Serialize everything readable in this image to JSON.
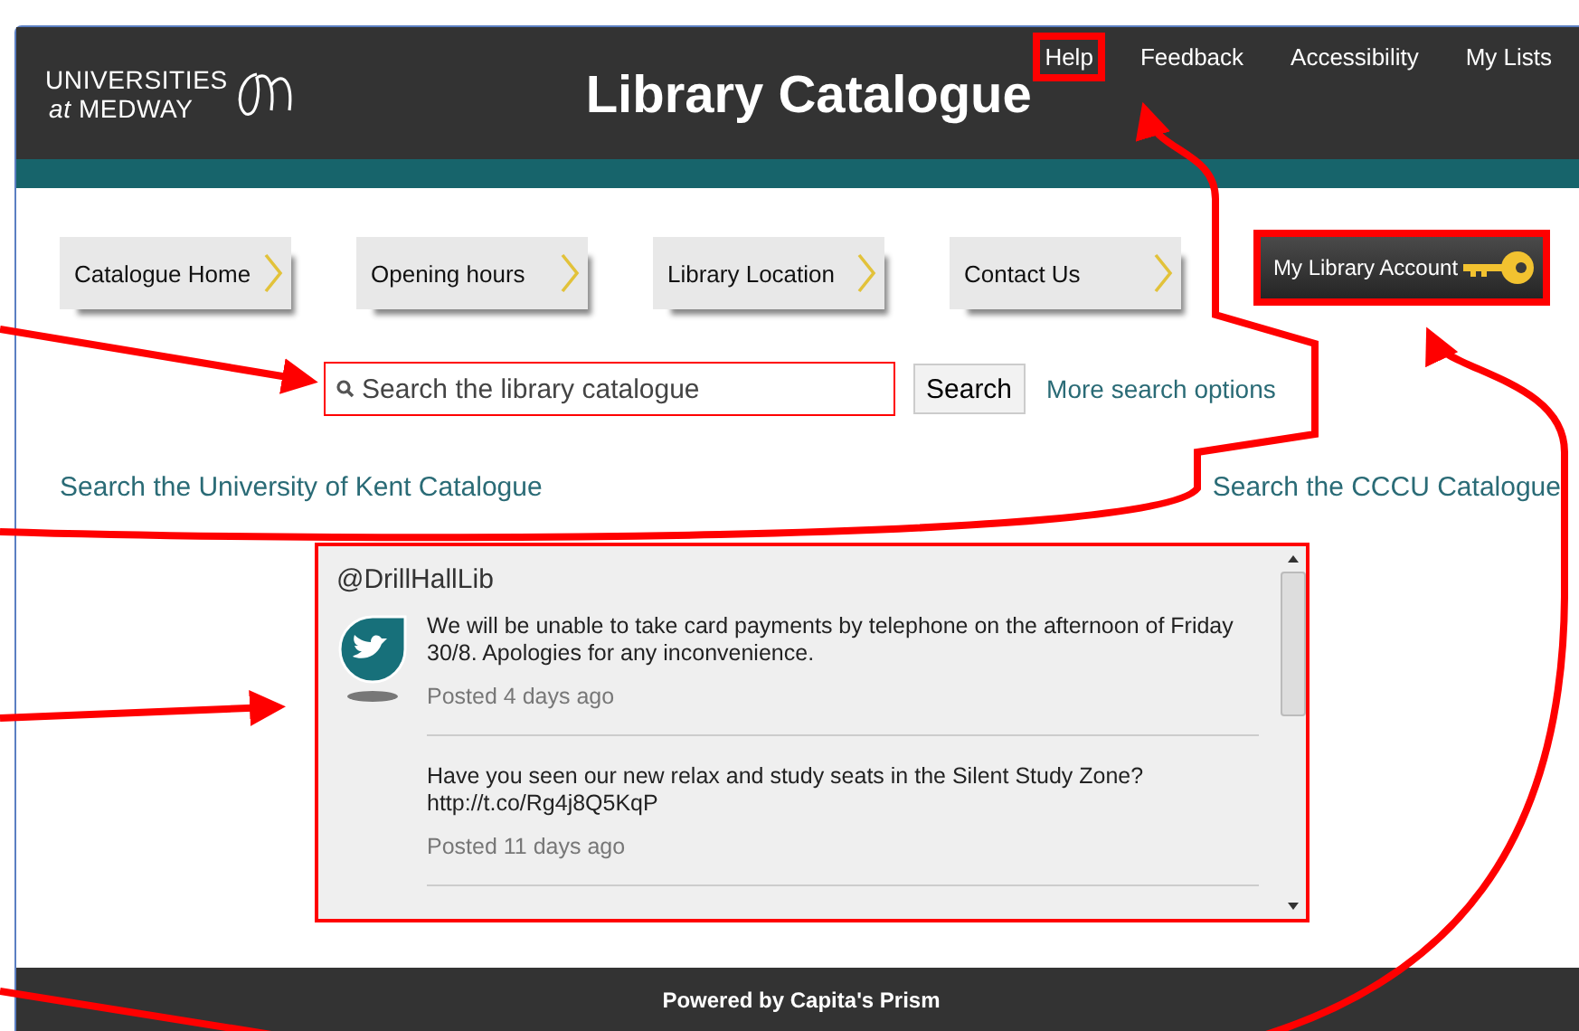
{
  "logo": {
    "line1": "UNIVERSITIES",
    "line2": "*at* MEDWAY"
  },
  "title": "Library Catalogue",
  "top_links": [
    {
      "label": "Help",
      "highlighted": true
    },
    {
      "label": "Feedback",
      "highlighted": false
    },
    {
      "label": "Accessibility",
      "highlighted": false
    },
    {
      "label": "My Lists",
      "highlighted": false
    }
  ],
  "nav": [
    {
      "label": "Catalogue Home",
      "kind": "tab",
      "highlighted": false
    },
    {
      "label": "Opening hours",
      "kind": "tab",
      "highlighted": false
    },
    {
      "label": "Library Location",
      "kind": "tab",
      "highlighted": false
    },
    {
      "label": "Contact Us",
      "kind": "tab",
      "highlighted": false
    },
    {
      "label": "My Library Account",
      "kind": "account",
      "highlighted": true
    }
  ],
  "search": {
    "placeholder": "Search the library catalogue",
    "button": "Search",
    "more_link": "More search options",
    "highlighted": true
  },
  "catalogue_links": [
    "Search the University of Kent Catalogue",
    "Search the CCCU Catalogue"
  ],
  "twitter": {
    "handle": "@DrillHallLib",
    "highlighted": true,
    "tweets": [
      {
        "text": "We will be unable to take card payments by telephone on the afternoon of Friday 30/8. Apologies for any inconvenience.",
        "posted": "Posted 4 days ago"
      },
      {
        "text": "Have you seen our new relax and study seats in the Silent Study Zone? http://t.co/Rg4j8Q5KqP",
        "posted": "Posted 11 days ago"
      }
    ]
  },
  "footer": "Powered by Capita's Prism"
}
